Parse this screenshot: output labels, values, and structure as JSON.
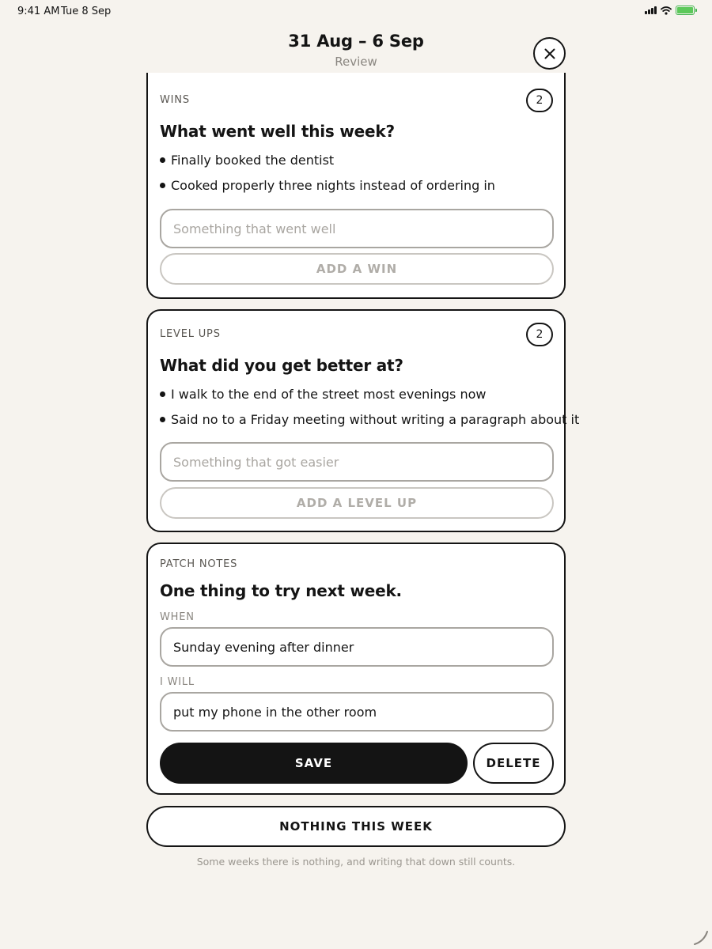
{
  "status_bar": {
    "time": "9:41 AM",
    "date": "Tue 8 Sep",
    "icons": [
      "signal-icon",
      "wifi-icon",
      "battery-charging-icon"
    ],
    "battery_color": "#5cc85a"
  },
  "header": {
    "title": "31 Aug – 6 Sep",
    "subtitle": "Review",
    "close_icon": "close-icon"
  },
  "wins": {
    "label": "WINS",
    "count": "2",
    "question": "What went well this week?",
    "items": [
      "Finally booked the dentist",
      "Cooked properly three nights instead of ordering in"
    ],
    "input_placeholder": "Something that went well",
    "input_value": "",
    "add_label": "ADD A WIN"
  },
  "level_ups": {
    "label": "LEVEL UPS",
    "count": "2",
    "question": "What did you get better at?",
    "items": [
      "I walk to the end of the street most evenings now",
      "Said no to a Friday meeting without writing a paragraph about it"
    ],
    "input_placeholder": "Something that got easier",
    "input_value": "",
    "add_label": "ADD A LEVEL UP"
  },
  "patch_notes": {
    "label": "PATCH NOTES",
    "question": "One thing to try next week.",
    "when_label": "WHEN",
    "when_value": "Sunday evening after dinner",
    "will_label": "I WILL",
    "will_value": "put my phone in the other room",
    "save_label": "SAVE",
    "delete_label": "DELETE"
  },
  "nothing_label": "NOTHING THIS WEEK",
  "footnote": "Some weeks there is nothing, and writing that down still counts.",
  "colors": {
    "background": "#f6f3ee",
    "ink": "#141414",
    "muted": "#8a8680",
    "disabled_border": "#c9c6c1"
  }
}
